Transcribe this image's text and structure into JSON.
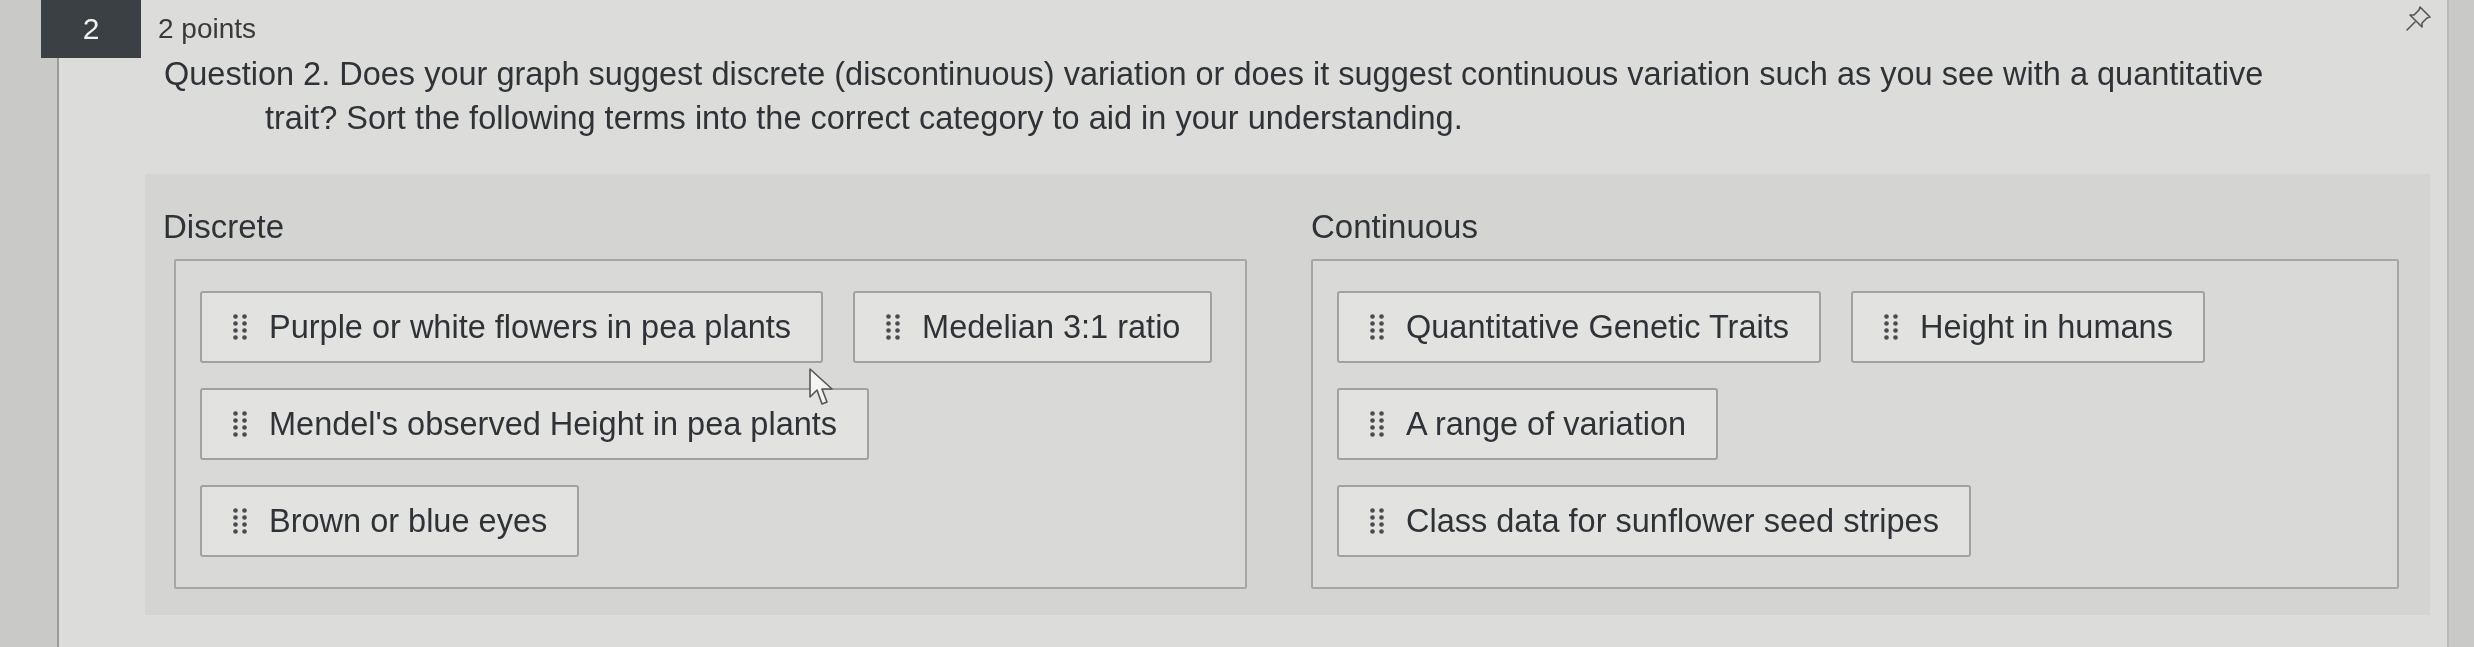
{
  "question_number": "2",
  "points": "2 points",
  "question": "Question 2. Does your graph suggest discrete (discontinuous) variation or does it suggest continuous variation such as you see with a quantitative trait? Sort the following terms into the correct category to aid in your understanding.",
  "categories": [
    {
      "title": "Discrete",
      "rows": [
        [
          "Purple or white flowers in pea plants",
          "Medelian 3:1 ratio"
        ],
        [
          "Mendel's observed Height in pea plants"
        ],
        [
          "Brown or blue eyes"
        ]
      ]
    },
    {
      "title": "Continuous",
      "rows": [
        [
          "Quantitative Genetic Traits",
          "Height in humans"
        ],
        [
          "A range of variation"
        ],
        [
          "Class data for sunflower seed stripes"
        ]
      ]
    }
  ]
}
